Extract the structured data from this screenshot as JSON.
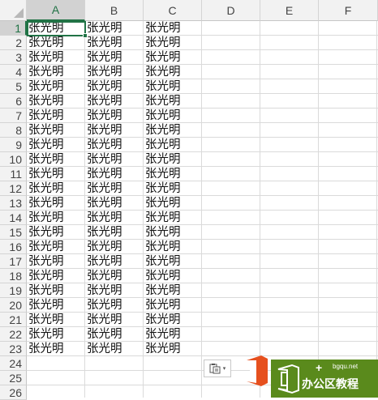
{
  "spreadsheet": {
    "columns": [
      "A",
      "B",
      "C",
      "D",
      "E",
      "F"
    ],
    "selected_column": "A",
    "rows": [
      "1",
      "2",
      "3",
      "4",
      "5",
      "6",
      "7",
      "8",
      "9",
      "10",
      "11",
      "12",
      "13",
      "14",
      "15",
      "16",
      "17",
      "18",
      "19",
      "20",
      "21",
      "22",
      "23",
      "24",
      "25",
      "26"
    ],
    "selected_row": "1",
    "active_cell": "A1",
    "cell_text": "张光明",
    "filled_rows": 23,
    "filled_columns": [
      "A",
      "B",
      "C"
    ],
    "colors": {
      "accent": "#217346",
      "header_bg": "#f2f2f2",
      "gridline": "#dadada"
    }
  },
  "paste_options": {
    "icon": "paste-options-icon",
    "chevron": "▾"
  },
  "watermark": {
    "url": "bgqu.net",
    "plus": "+",
    "title": "办公区教程",
    "logo_icon": "office-logo-icon",
    "color": "#5a8a1c"
  }
}
